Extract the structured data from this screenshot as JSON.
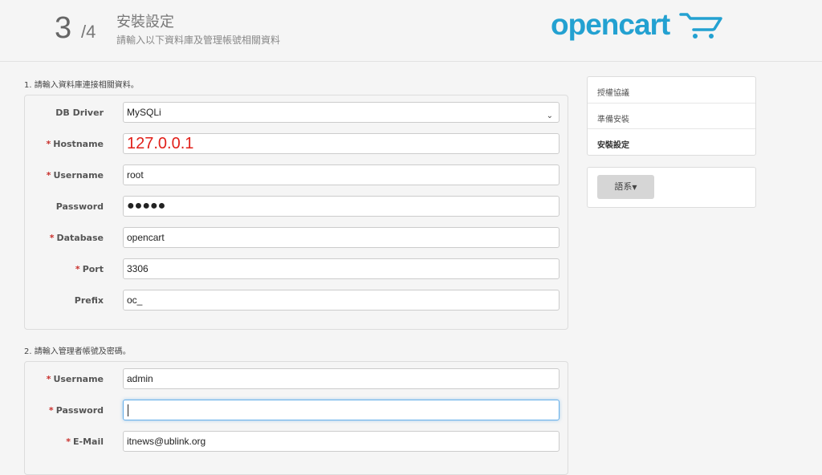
{
  "header": {
    "step_number": "3",
    "step_total": "/4",
    "title": "安裝設定",
    "subtitle": "請輸入以下資料庫及管理帳號相關資料",
    "logo_text": "opencart",
    "logo_color": "#23a1d1"
  },
  "db_section": {
    "legend": "1. 請輸入資料庫連接相關資料。",
    "fields": [
      {
        "label": "DB Driver",
        "required": false,
        "value": "MySQLi",
        "type": "select"
      },
      {
        "label": "Hostname",
        "required": true,
        "value": "127.0.0.1"
      },
      {
        "label": "Username",
        "required": true,
        "value": "root"
      },
      {
        "label": "Password",
        "required": false,
        "value": "●●●●●"
      },
      {
        "label": "Database",
        "required": true,
        "value": "opencart"
      },
      {
        "label": "Port",
        "required": true,
        "value": "3306"
      },
      {
        "label": "Prefix",
        "required": false,
        "value": "oc_"
      }
    ]
  },
  "admin_section": {
    "legend": "2. 請輸入管理者帳號及密碼。",
    "fields": [
      {
        "label": "Username",
        "required": true,
        "value": "admin"
      },
      {
        "label": "Password",
        "required": true,
        "value": ""
      },
      {
        "label": "E-Mail",
        "required": true,
        "value": "itnews@ublink.org"
      }
    ]
  },
  "sidebar": {
    "steps": [
      {
        "label": "授權協議"
      },
      {
        "label": "準備安裝"
      },
      {
        "label": "安裝設定"
      }
    ],
    "language_button": "語系"
  },
  "icons": {
    "cart": "cart-icon",
    "select_arrow": "chevron-down-icon",
    "caret": "caret-down-icon"
  },
  "required_marker": "*"
}
